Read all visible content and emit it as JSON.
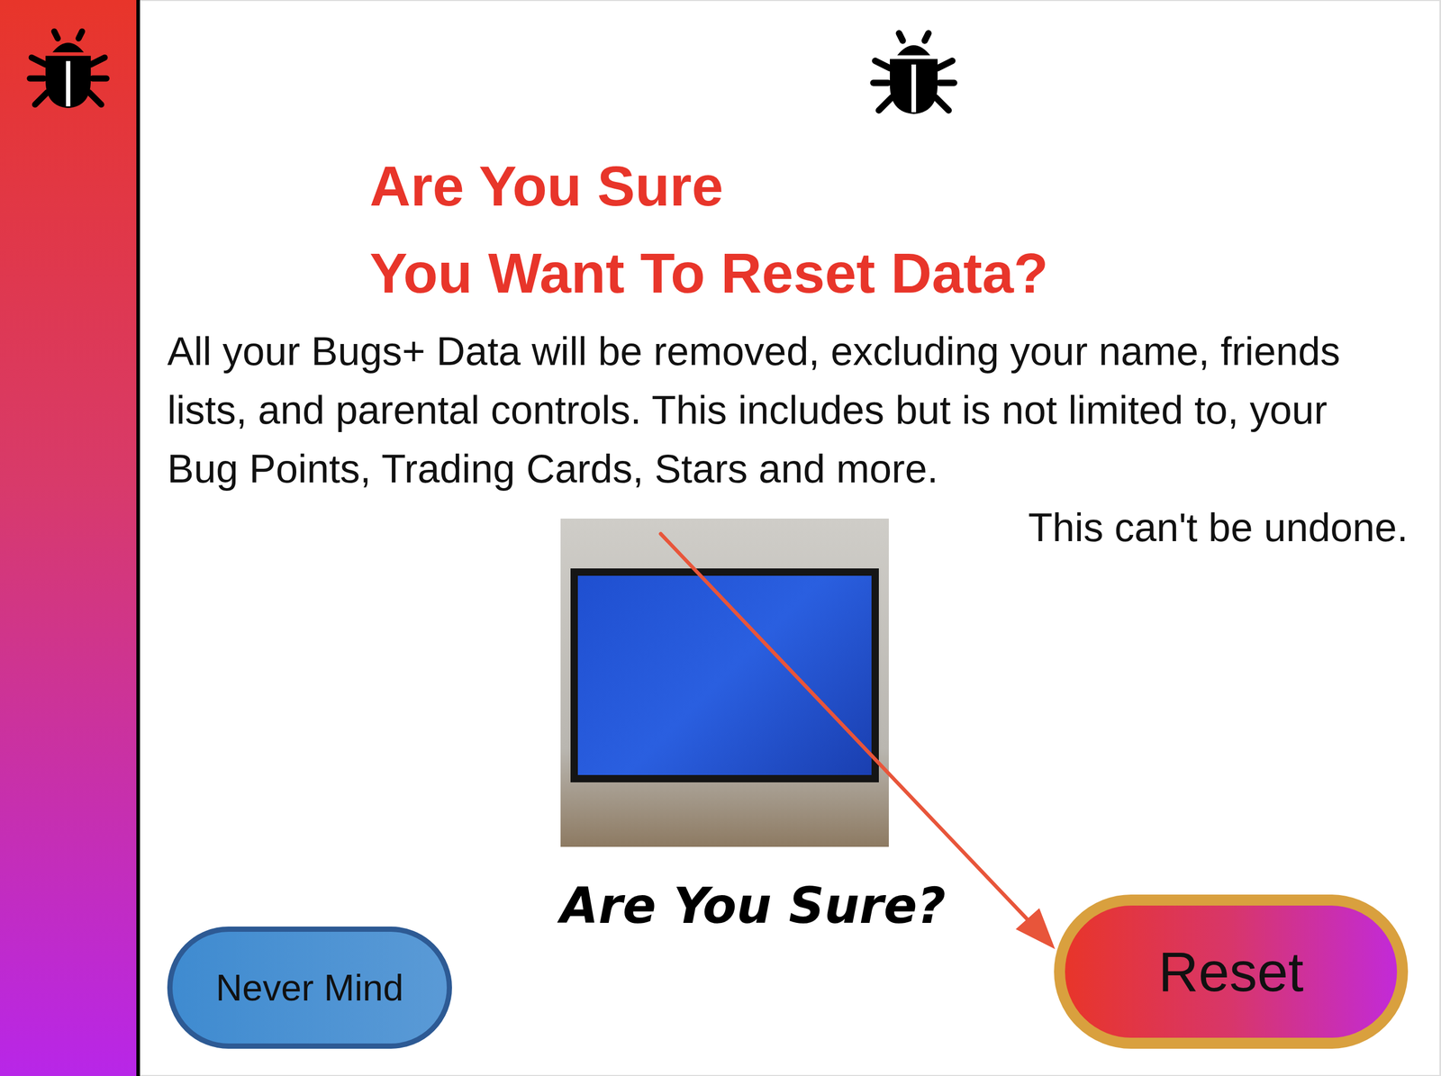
{
  "dialog": {
    "title_lines": [
      "Are You Sure",
      "You Want To Reset Data?"
    ],
    "message": "All your Bugs+ Data will be removed, excluding your name, friends lists, and parental controls. This includes but is not limited to, your Bug Points, Trading Cards, Stars and more.",
    "warning": "This can't be undone.",
    "caption": "Are You Sure?"
  },
  "buttons": [
    {
      "label": "Never Mind",
      "kind": "cancel",
      "highlighted": false
    },
    {
      "label": "Reset",
      "kind": "confirm",
      "highlighted": true
    }
  ]
}
